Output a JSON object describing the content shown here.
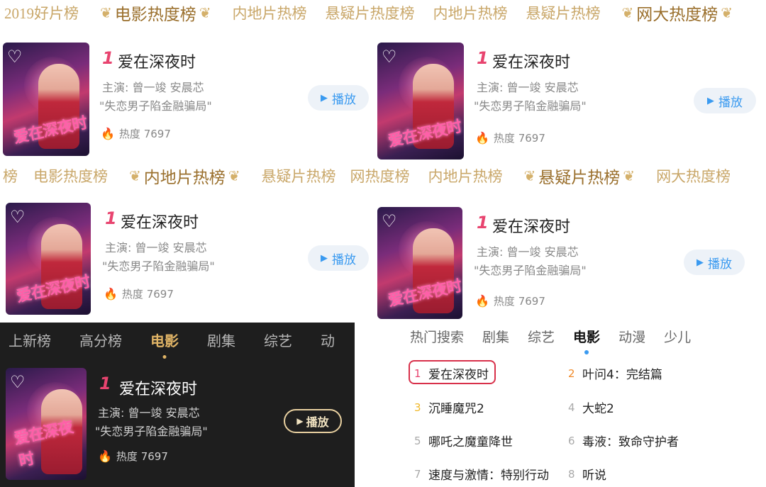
{
  "strip1": {
    "tabs": [
      "2019好片榜",
      "电影热度榜",
      "内地片热榜",
      "悬疑片热度榜",
      "内地片热榜",
      "悬疑片热榜",
      "网大热度榜"
    ]
  },
  "strip2": {
    "tabs": [
      "榜",
      "电影热度榜",
      "内地片热榜",
      "悬疑片热榜",
      "网热度榜",
      "内地片热榜",
      "悬疑片热榜",
      "网大热度榜"
    ]
  },
  "movie": {
    "rank": "1",
    "title": "爱在深夜时",
    "cast": "主演: 曾一竣 安晨芯",
    "tagline": "\"失恋男子陷金融骗局\"",
    "heat": "热度 7697",
    "poster_art": "爱在深夜时",
    "play_label": "播放"
  },
  "dark_tabs": [
    "上新榜",
    "高分榜",
    "电影",
    "剧集",
    "综艺",
    "动"
  ],
  "list_tabs": [
    "热门搜索",
    "剧集",
    "综艺",
    "电影",
    "动漫",
    "少儿"
  ],
  "ranking": [
    {
      "num": "1",
      "title": "爱在深夜时"
    },
    {
      "num": "2",
      "title": "叶问4：完结篇"
    },
    {
      "num": "3",
      "title": "沉睡魔咒2"
    },
    {
      "num": "4",
      "title": "大蛇2"
    },
    {
      "num": "5",
      "title": "哪吒之魔童降世"
    },
    {
      "num": "6",
      "title": "毒液：致命守护者"
    },
    {
      "num": "7",
      "title": "速度与激情：特别行动"
    },
    {
      "num": "8",
      "title": "听说"
    }
  ],
  "colors": {
    "gold": "#c9a769",
    "gold_active": "#9a6f2c",
    "accent_blue": "#3a9af0",
    "rank_red": "#e8446f",
    "highlight": "#d8304a"
  }
}
